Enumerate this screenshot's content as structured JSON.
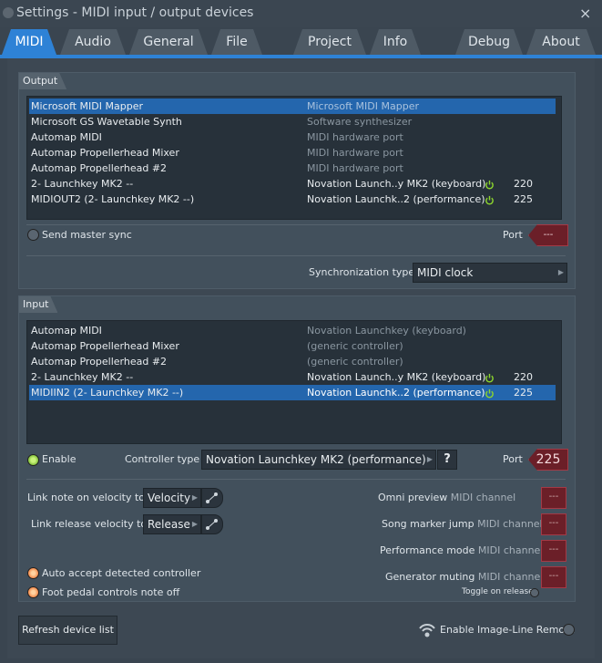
{
  "window": {
    "title": "Settings - MIDI input / output devices",
    "close": "×"
  },
  "tabs": [
    "MIDI",
    "Audio",
    "General",
    "File",
    "Project",
    "Info",
    "Debug",
    "About"
  ],
  "output": {
    "header": "Output",
    "rows": [
      {
        "name": "Microsoft MIDI Mapper",
        "type": "Microsoft MIDI Mapper",
        "port": "",
        "selected": true
      },
      {
        "name": "Microsoft GS Wavetable Synth",
        "type": "Software synthesizer",
        "port": ""
      },
      {
        "name": "Automap MIDI",
        "type": "MIDI hardware port",
        "port": ""
      },
      {
        "name": "Automap Propellerhead Mixer",
        "type": "MIDI hardware port",
        "port": ""
      },
      {
        "name": "Automap Propellerhead #2",
        "type": "MIDI hardware port",
        "port": ""
      },
      {
        "name": "2- Launchkey MK2 --",
        "type": "Novation Launch..y MK2 (keyboard)",
        "port": "220",
        "active": true
      },
      {
        "name": "MIDIOUT2 (2- Launchkey MK2 --)",
        "type": "Novation Launchk..2 (performance)",
        "port": "225",
        "active": true
      }
    ],
    "send_master_sync": "Send master sync",
    "port_label": "Port",
    "port_value": "---",
    "sync_label": "Synchronization type",
    "sync_value": "MIDI clock"
  },
  "input": {
    "header": "Input",
    "rows": [
      {
        "name": "Automap MIDI",
        "type": "Novation Launchkey (keyboard)",
        "port": ""
      },
      {
        "name": "Automap Propellerhead Mixer",
        "type": "(generic controller)",
        "port": ""
      },
      {
        "name": "Automap Propellerhead #2",
        "type": "(generic controller)",
        "port": ""
      },
      {
        "name": "2- Launchkey MK2 --",
        "type": "Novation Launch..y MK2 (keyboard)",
        "port": "220",
        "active": true
      },
      {
        "name": "MIDIIN2 (2- Launchkey MK2 --)",
        "type": "Novation Launchk..2 (performance)",
        "port": "225",
        "active": true,
        "selected": true
      }
    ],
    "enable": "Enable",
    "controller_type_label": "Controller type",
    "controller_type_value": "Novation Launchkey MK2 (performance)",
    "help": "?",
    "port_label": "Port",
    "port_value": "225"
  },
  "options": {
    "link_note_label": "Link note on velocity to",
    "link_note_value": "Velocity",
    "link_release_label": "Link release velocity to",
    "link_release_value": "Release",
    "auto_accept": "Auto accept detected controller",
    "foot_pedal": "Foot pedal controls note off",
    "omni_label": "Omni preview",
    "song_marker_label": "Song marker jump",
    "performance_label": "Performance mode",
    "generator_label": "Generator muting",
    "midi_channel": "MIDI channel",
    "channel_value": "---",
    "toggle_on_release": "Toggle on release"
  },
  "footer": {
    "refresh": "Refresh device list",
    "remote": "Enable Image-Line Remote"
  },
  "colors": {
    "accent": "#2e82d6",
    "selection": "#2466ad",
    "port_box": "#6b1f28",
    "power_green": "#8bd32e"
  }
}
